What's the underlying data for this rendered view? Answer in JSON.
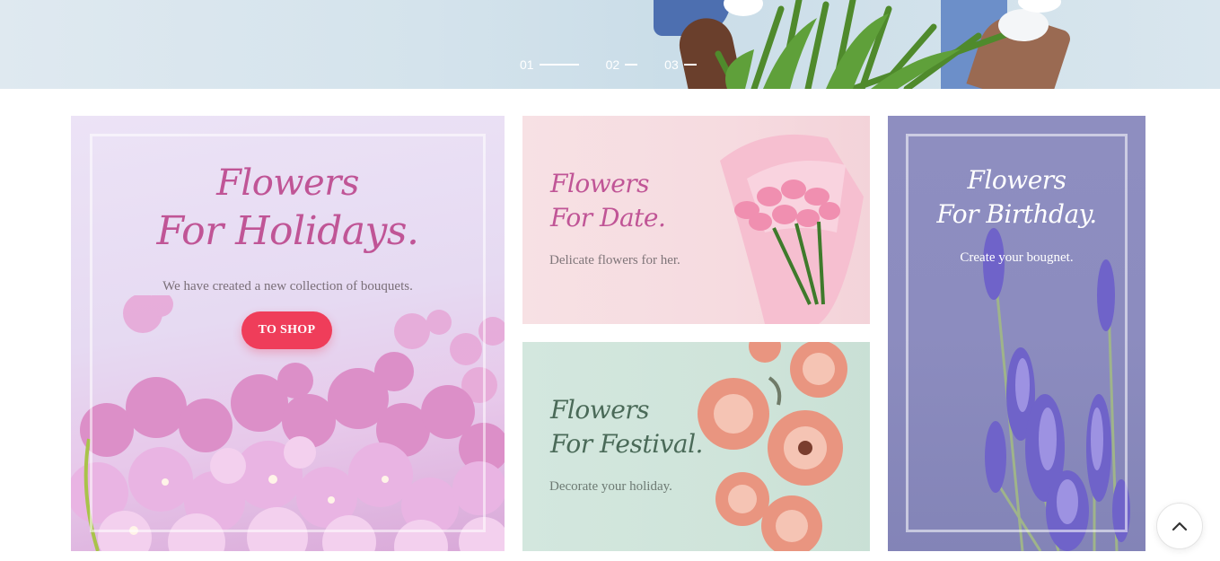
{
  "hero": {
    "slides": [
      {
        "label": "01",
        "active": true
      },
      {
        "label": "02",
        "active": false
      },
      {
        "label": "03",
        "active": false
      }
    ]
  },
  "banners": {
    "holidays": {
      "title_line1": "Flowers",
      "title_line2": "For Holidays.",
      "description": "We have created a new collection of bouquets.",
      "button_label": "TO SHOP"
    },
    "date": {
      "title_line1": "Flowers",
      "title_line2": "For Date.",
      "description": "Delicate flowers for her."
    },
    "festival": {
      "title_line1": "Flowers",
      "title_line2": "For Festival.",
      "description": "Decorate your holiday."
    },
    "birthday": {
      "title_line1": "Flowers",
      "title_line2": "For Birthday.",
      "description": "Create your bougnet."
    }
  },
  "colors": {
    "accent_button": "#ef3d5a",
    "script_pink": "#c05596",
    "script_green": "#4a6a58"
  },
  "icons": {
    "scroll_top": "chevron-up-icon"
  }
}
